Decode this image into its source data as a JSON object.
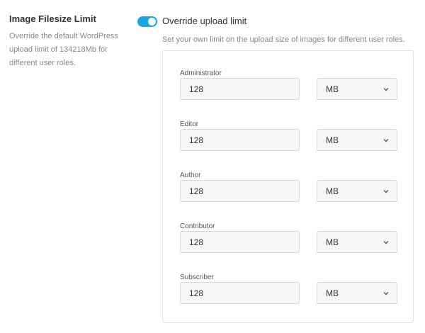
{
  "section": {
    "title": "Image Filesize Limit",
    "description": "Override the default WordPress upload limit of 134218Mb for different user roles."
  },
  "override": {
    "enabled": true,
    "label": "Override upload limit",
    "hint": "Set your own limit on the upload size of images for different user roles."
  },
  "roles": [
    {
      "label": "Administrator",
      "value": "128",
      "unit": "MB"
    },
    {
      "label": "Editor",
      "value": "128",
      "unit": "MB"
    },
    {
      "label": "Author",
      "value": "128",
      "unit": "MB"
    },
    {
      "label": "Contributor",
      "value": "128",
      "unit": "MB"
    },
    {
      "label": "Subscriber",
      "value": "128",
      "unit": "MB"
    }
  ],
  "icons": {
    "toggle": "toggle-switch",
    "dropdown": "chevron-down-icon"
  },
  "colors": {
    "toggle_on": "#17a8e3"
  }
}
